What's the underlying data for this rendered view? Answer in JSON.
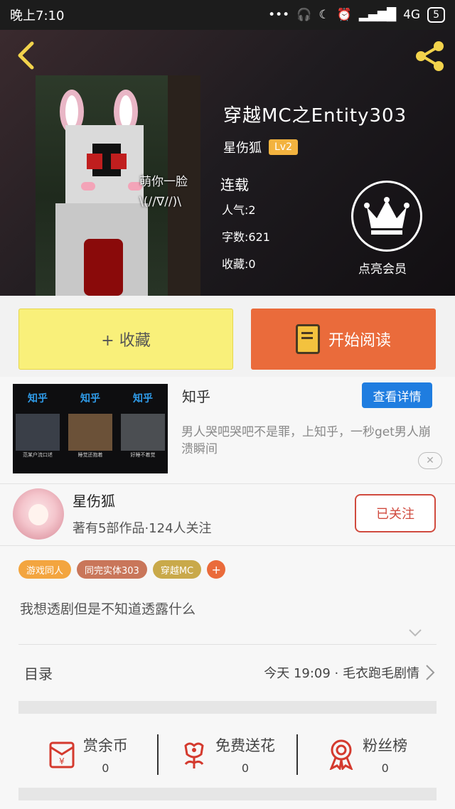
{
  "status_bar": {
    "time": "晚上7:10",
    "network": "4G",
    "battery": "5"
  },
  "book": {
    "title": "穿越MC之Entity303",
    "cover_caption": "萌你一脸\n\\(//∇//)\\",
    "author": "星伤狐",
    "level": "Lv2",
    "status": "连载",
    "popularity": "人气:2",
    "word_count": "字数:621",
    "favorites": "收藏:0",
    "vip_label": "点亮会员"
  },
  "buttons": {
    "collect": "+ 收藏",
    "read": "开始阅读"
  },
  "ad": {
    "thumb_logo": "知乎",
    "thumb_subs": [
      "范某户流口述",
      "睡觉还抱着",
      "好睡不着觉"
    ],
    "source": "知乎",
    "detail_button": "查看详情",
    "text": "男人哭吧哭吧不是罪，上知乎，一秒get男人崩溃瞬间",
    "close": "✕"
  },
  "author_card": {
    "name": "星伤狐",
    "info": "著有5部作品·124人关注",
    "follow_button": "已关注"
  },
  "tags": [
    {
      "label": "游戏同人",
      "color": "#f3a53f"
    },
    {
      "label": "同完实体303",
      "color": "#c9765a"
    },
    {
      "label": "穿越MC",
      "color": "#c9a94a"
    }
  ],
  "tag_add": "+",
  "description": "我想透剧但是不知道透露什么",
  "catalog": {
    "label": "目录",
    "latest": "今天 19:09 · 毛衣跑毛剧情"
  },
  "actions": [
    {
      "label": "赏余币",
      "count": "0",
      "icon": "red-envelope-icon"
    },
    {
      "label": "免费送花",
      "count": "0",
      "icon": "flower-icon"
    },
    {
      "label": "粉丝榜",
      "count": "0",
      "icon": "medal-icon"
    }
  ],
  "colors": {
    "accent_orange": "#ea6b3b",
    "collect_yellow": "#f9f07a",
    "follow_red": "#d04a3e",
    "detail_blue": "#1f7de0"
  }
}
